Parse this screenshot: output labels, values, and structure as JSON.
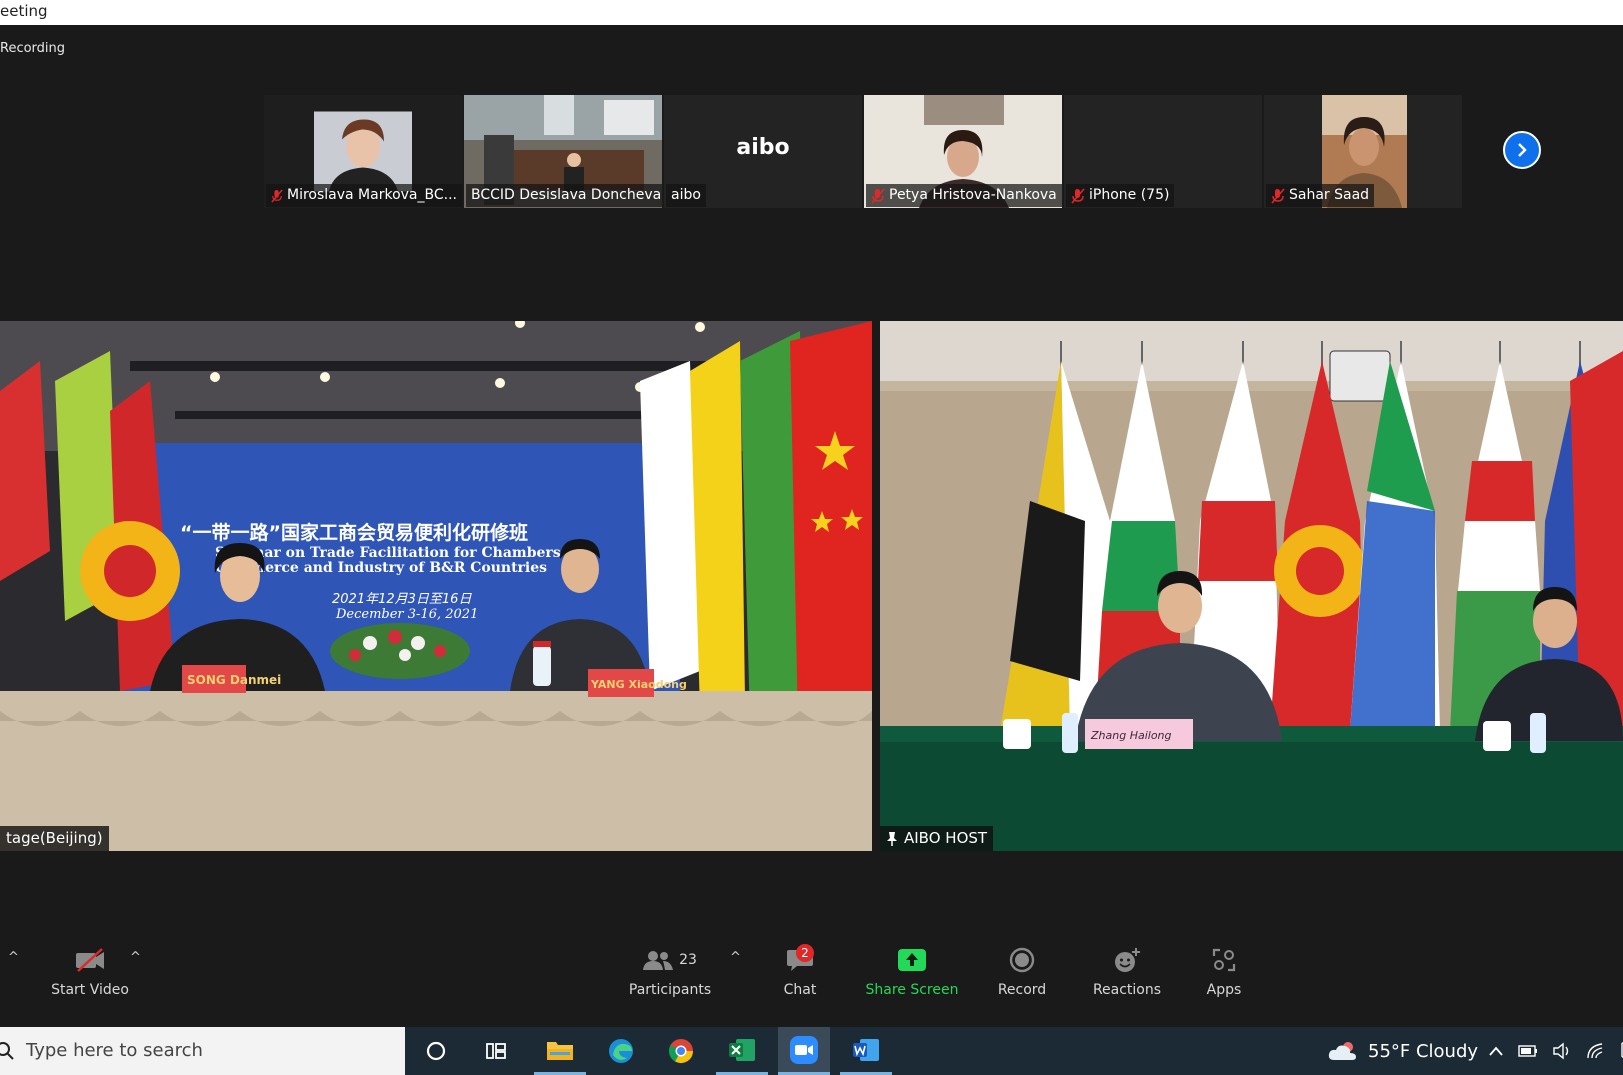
{
  "window": {
    "title": "eeting"
  },
  "recording": {
    "label": "Recording"
  },
  "participants_strip": [
    {
      "name": "Miroslava Markova_BC...",
      "muted": true,
      "kind": "video"
    },
    {
      "name": "BCCID Desislava Doncheva",
      "muted": false,
      "kind": "video"
    },
    {
      "name": "aibo",
      "muted": false,
      "kind": "text",
      "display": "aibo"
    },
    {
      "name": "Petya Hristova-Nankova",
      "muted": true,
      "kind": "video"
    },
    {
      "name": "iPhone (75)",
      "muted": true,
      "kind": "blank"
    },
    {
      "name": "Sahar Saad",
      "muted": true,
      "kind": "video"
    }
  ],
  "main_videos": {
    "left": {
      "label": "tage(Beijing)",
      "banner_cn": "“一带一路”国家工商会贸易便利化研修班",
      "banner_en1": "Seminar on Trade Facilitation for Chambers of",
      "banner_en2": "Commerce and Industry of B&R Countries",
      "banner_date_cn": "2021年12月3日至16日",
      "banner_date_en": "December 3-16, 2021",
      "nameplate_1": "SONG Danmei",
      "nameplate_2": "YANG Xiaodong"
    },
    "right": {
      "label": "AIBO HOST",
      "nameplate": "Zhang Hailong"
    }
  },
  "toolbar": {
    "start_video": "Start Video",
    "participants": "Participants",
    "participants_count": "23",
    "chat": "Chat",
    "chat_badge": "2",
    "share_screen": "Share Screen",
    "record": "Record",
    "reactions": "Reactions",
    "apps": "Apps"
  },
  "taskbar": {
    "search_placeholder": "Type here to search",
    "weather": "55°F  Cloudy"
  },
  "colors": {
    "share_green": "#23d959",
    "zoom_blue": "#0e71eb",
    "badge_red": "#e02828"
  }
}
